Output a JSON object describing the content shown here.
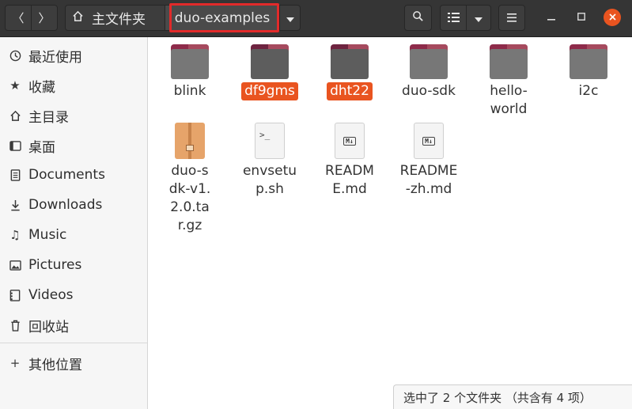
{
  "header": {
    "back_icon": "chevron-left-icon",
    "forward_icon": "chevron-right-icon",
    "path_home": "主文件夹",
    "path_current": "duo-examples",
    "accent": "#e22a2a"
  },
  "sidebar": {
    "items": [
      {
        "label": "最近使用",
        "icon": "clock-icon"
      },
      {
        "label": "收藏",
        "icon": "star-icon"
      },
      {
        "label": "主目录",
        "icon": "home-icon"
      },
      {
        "label": "桌面",
        "icon": "desktop-icon"
      },
      {
        "label": "Documents",
        "icon": "document-icon"
      },
      {
        "label": "Downloads",
        "icon": "download-icon"
      },
      {
        "label": "Music",
        "icon": "music-icon"
      },
      {
        "label": "Pictures",
        "icon": "pictures-icon"
      },
      {
        "label": "Videos",
        "icon": "videos-icon"
      },
      {
        "label": "回收站",
        "icon": "trash-icon"
      },
      {
        "label": "其他位置",
        "icon": "plus-icon"
      }
    ]
  },
  "files": [
    {
      "name": "blink",
      "type": "folder",
      "selected": false
    },
    {
      "name": "df9gms",
      "type": "folder",
      "selected": true
    },
    {
      "name": "dht22",
      "type": "folder",
      "selected": true
    },
    {
      "name": "duo-sdk",
      "type": "folder",
      "selected": false
    },
    {
      "name": "hello-world",
      "type": "folder",
      "selected": false
    },
    {
      "name": "i2c",
      "type": "folder",
      "selected": false
    },
    {
      "name": "duo-sdk-v1.2.0.tar.gz",
      "type": "archive",
      "selected": false
    },
    {
      "name": "envsetup.sh",
      "type": "script",
      "selected": false
    },
    {
      "name": "README.md",
      "type": "markdown",
      "selected": false
    },
    {
      "name": "README-zh.md",
      "type": "markdown",
      "selected": false
    }
  ],
  "labels": {
    "blink": "blink",
    "df9gms": "df9gms",
    "dht22": "dht22",
    "duo_sdk": "duo-sdk",
    "hello_world": "hello-world",
    "i2c": "i2c",
    "tarball": "duo-sdk-v1.2.0.tar.gz",
    "envsetup": "envsetup.sh",
    "readme": "README.md",
    "readme_zh": "README-zh.md"
  },
  "status": {
    "text": "选中了 2 个文件夹 （共含有 4 项）"
  },
  "colors": {
    "selection": "#e95420",
    "folder_tab": "#8e2b4a",
    "headerbar": "#353535"
  }
}
